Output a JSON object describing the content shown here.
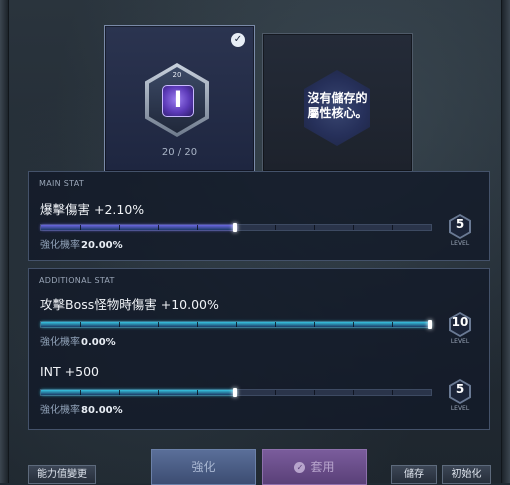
{
  "core_slot": {
    "level_badge": "20",
    "icon_glyph": "I",
    "count": "20 / 20",
    "selected_icon": "check-icon"
  },
  "empty_slot": {
    "text_line1": "沒有儲存的",
    "text_line2": "屬性核心。"
  },
  "main_stat": {
    "title": "MAIN STAT",
    "name": "爆擊傷害 +2.10%",
    "progress": 0.5,
    "bar_color": "#6b67e0",
    "rate_label": "強化機率",
    "rate_value": "20.00%",
    "level": "5",
    "level_label": "LEVEL"
  },
  "additional_stat": {
    "title": "ADDITIONAL STAT",
    "stats": [
      {
        "name": "攻擊Boss怪物時傷害 +10.00%",
        "progress": 1.0,
        "bar_color": "#37c3df",
        "rate_label": "強化機率",
        "rate_value": "0.00%",
        "level": "10",
        "level_label": "LEVEL"
      },
      {
        "name": "INT +500",
        "progress": 0.5,
        "bar_color": "#37c3df",
        "rate_label": "強化機率",
        "rate_value": "80.00%",
        "level": "5",
        "level_label": "LEVEL"
      }
    ]
  },
  "buttons": {
    "change": "能力值變更",
    "enhance": "強化",
    "apply": "套用",
    "save": "儲存",
    "init": "初始化"
  }
}
